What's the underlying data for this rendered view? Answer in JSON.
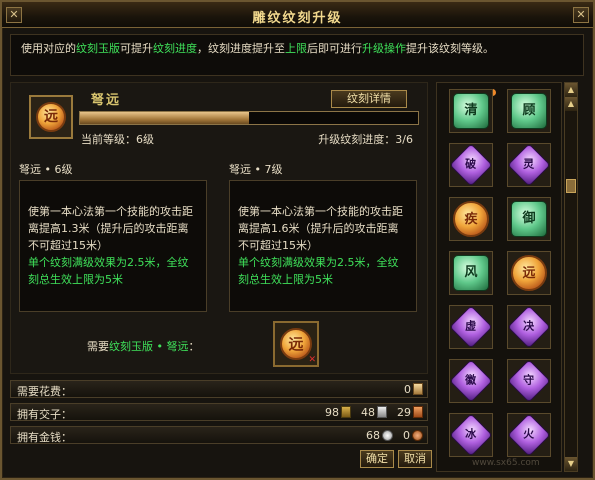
{
  "window": {
    "title": "雕纹纹刻升级",
    "close_left": "✕",
    "close_right": "✕"
  },
  "description": {
    "part1": "使用对应的",
    "link1": "纹刻玉版",
    "part2": "可提升",
    "link2": "纹刻进度",
    "part3": "，纹刻进度提升至",
    "link3": "上限",
    "part4": "后即可进行",
    "link4": "升级操作",
    "part5": "提升该纹刻等级。"
  },
  "item": {
    "name": "弩远",
    "gem_char": "远",
    "detail_button": "纹刻详情",
    "progress": {
      "current": 3,
      "max": 6
    },
    "current_level_label": "当前等级：6级",
    "progress_label": "升级纹刻进度：3/6"
  },
  "levels": [
    {
      "title": "弩远 • 6级",
      "text": "使第一本心法第一个技能的攻击距离提高1.3米（提升后的攻击距离不可超过15米）",
      "bonus": "单个纹刻满级效果为2.5米，全纹刻总生效上限为5米"
    },
    {
      "title": "弩远 • 7级",
      "text": "使第一本心法第一个技能的攻击距离提高1.6米（提升后的攻击距离不可超过15米）",
      "bonus": "单个纹刻满级效果为2.5米，全纹刻总生效上限为5米"
    }
  ],
  "requirement": {
    "prefix": "需要",
    "item_link": "纹刻玉版 • 弩远",
    "suffix": "：",
    "gem_char": "远"
  },
  "resources": {
    "cost_label": "需要花费：",
    "cost_value": "0",
    "notes_label": "拥有交子：",
    "notes": [
      "98",
      "48",
      "29"
    ],
    "money_label": "拥有金钱：",
    "money": [
      "68",
      "0"
    ]
  },
  "buttons": {
    "confirm": "确定",
    "cancel": "取消"
  },
  "grid_tiles": [
    {
      "kind": "jade",
      "char": "清"
    },
    {
      "kind": "jade",
      "char": "顾"
    },
    {
      "kind": "purple",
      "char": "破"
    },
    {
      "kind": "purple",
      "char": "灵"
    },
    {
      "kind": "orange",
      "char": "疾"
    },
    {
      "kind": "jade",
      "char": "御"
    },
    {
      "kind": "jade",
      "char": "风"
    },
    {
      "kind": "orange",
      "char": "远"
    },
    {
      "kind": "purple",
      "char": "虚"
    },
    {
      "kind": "purple",
      "char": "决"
    },
    {
      "kind": "purple",
      "char": "徽"
    },
    {
      "kind": "purple",
      "char": "守"
    },
    {
      "kind": "purple",
      "char": "冰"
    },
    {
      "kind": "purple",
      "char": "火"
    }
  ],
  "watermark": "www.sx65.com",
  "colors": {
    "accent": "#f2d98e",
    "highlight_green": "#3fe15a",
    "highlight_yellow": "#f4c542"
  }
}
